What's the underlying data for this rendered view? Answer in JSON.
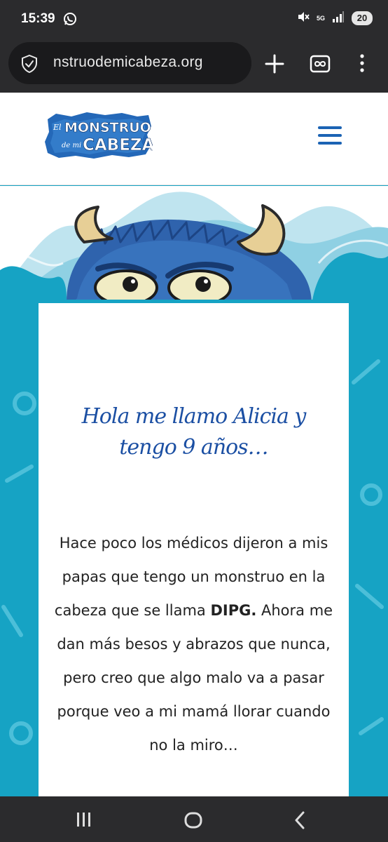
{
  "status_bar": {
    "time": "15:39",
    "network": "5G",
    "battery": "20"
  },
  "browser": {
    "url": "nstruodemicabeza.org"
  },
  "site": {
    "logo": {
      "line1": "El MONSTRUO",
      "line2_small": "de mi",
      "line2": "CABEZA"
    }
  },
  "content": {
    "title": "Hola me llamo Alicia y tengo 9 años…",
    "body": {
      "part1": "Hace poco los médicos dijeron a mis papas que tengo un monstruo en la cabeza que se llama ",
      "bold": "DIPG.",
      "part2": " Ahora me dan más besos y abrazos que nunca, pero creo que algo malo va a pasar porque veo a mi mamá llorar cuando no la miro…"
    }
  },
  "icons": {
    "whatsapp": "whatsapp-icon",
    "mute": "mute-icon",
    "signal": "signal-icon",
    "security": "shield-icon",
    "new_tab": "plus-icon",
    "tab_switcher": "infinity-icon",
    "overflow": "kebab-menu-icon",
    "site_menu": "hamburger-icon",
    "recents": "recents-icon",
    "home": "home-icon",
    "back": "back-icon"
  },
  "colors": {
    "site_blue": "#1b63b4",
    "hero_teal": "#16a3c4",
    "monster_blue": "#2f63ad",
    "title_blue": "#1b4fa3",
    "system_bar": "#2b2b2d"
  }
}
